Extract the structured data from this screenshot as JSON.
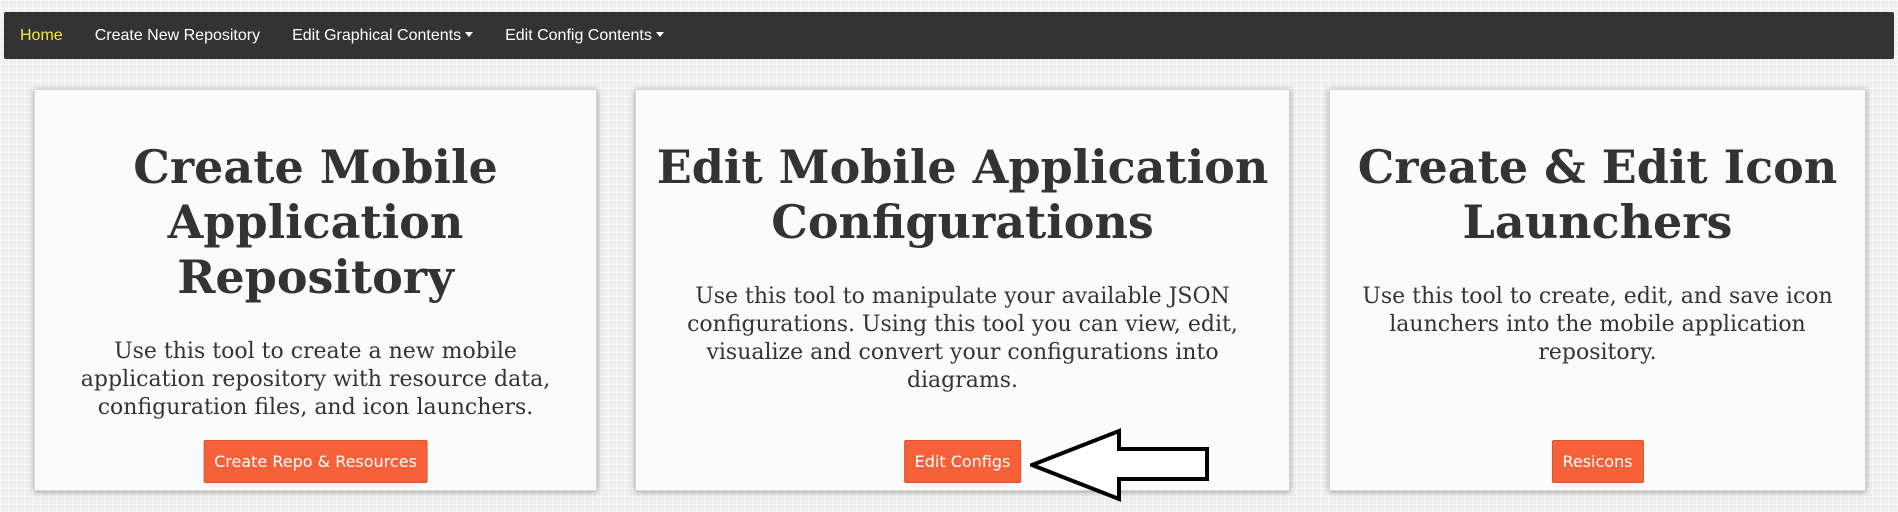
{
  "navbar": {
    "home": "Home",
    "create_repo": "Create New Repository",
    "edit_graphical": "Edit Graphical Contents",
    "edit_config": "Edit Config Contents"
  },
  "cards": [
    {
      "title": "Create Mobile Application Repository",
      "description": "Use this tool to create a new mobile application repository with resource data, configuration files, and icon launchers.",
      "button": "Create Repo & Resources"
    },
    {
      "title": "Edit Mobile Application Configurations",
      "description": "Use this tool to manipulate your available JSON configurations. Using this tool you can view, edit, visualize and convert your configurations into diagrams.",
      "button": "Edit Configs"
    },
    {
      "title": "Create & Edit Icon Launchers",
      "description": "Use this tool to create, edit, and save icon launchers into the mobile application repository.",
      "button": "Resicons"
    }
  ],
  "colors": {
    "navbar_bg": "#333333",
    "active_nav": "#f6e93a",
    "button_bg": "#f7613a"
  },
  "icons": {
    "dropdown": "caret-down-icon",
    "annotation": "left-arrow-icon"
  }
}
